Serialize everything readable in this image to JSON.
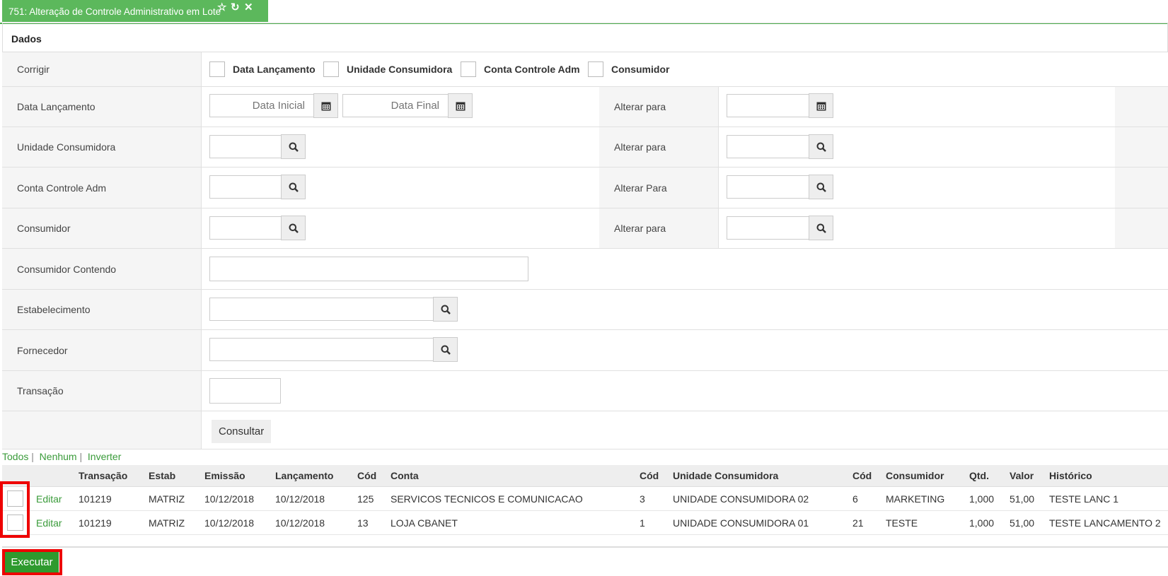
{
  "tab": {
    "title": "751: Alteração de Controle Administrativo em Lote",
    "star_icon": "☆",
    "refresh_icon": "↻",
    "close_icon": "✕"
  },
  "section": {
    "title": "Dados"
  },
  "form": {
    "corrigir_label": "Corrigir",
    "corrigir_options": [
      "Data Lançamento",
      "Unidade Consumidora",
      "Conta Controle Adm",
      "Consumidor"
    ],
    "data_lancamento": {
      "label": "Data Lançamento",
      "placeholder_inicial": "Data Inicial",
      "placeholder_final": "Data Final",
      "alterar_label": "Alterar para"
    },
    "unidade_consumidora": {
      "label": "Unidade Consumidora",
      "alterar_label": "Alterar para"
    },
    "conta_controle": {
      "label": "Conta Controle Adm",
      "alterar_label": "Alterar Para"
    },
    "consumidor": {
      "label": "Consumidor",
      "alterar_label": "Alterar para"
    },
    "consumidor_contendo": {
      "label": "Consumidor Contendo"
    },
    "estabelecimento": {
      "label": "Estabelecimento"
    },
    "fornecedor": {
      "label": "Fornecedor"
    },
    "transacao": {
      "label": "Transação"
    },
    "consultar_button": "Consultar"
  },
  "selection_links": {
    "todos": "Todos",
    "nenhum": "Nenhum",
    "inverter": "Inverter",
    "separator": "|"
  },
  "table": {
    "headers": [
      "Transação",
      "Estab",
      "Emissão",
      "Lançamento",
      "Cód",
      "Conta",
      "Cód",
      "Unidade Consumidora",
      "Cód",
      "Consumidor",
      "Qtd.",
      "Valor",
      "Histórico"
    ],
    "edit_label": "Editar",
    "rows": [
      [
        "101219",
        "MATRIZ",
        "10/12/2018",
        "10/12/2018",
        "125",
        "SERVICOS TECNICOS E COMUNICACAO",
        "3",
        "UNIDADE CONSUMIDORA 02",
        "6",
        "MARKETING",
        "1,000",
        "51,00",
        "TESTE LANC 1"
      ],
      [
        "101219",
        "MATRIZ",
        "10/12/2018",
        "10/12/2018",
        "13",
        "LOJA CBANET",
        "1",
        "UNIDADE CONSUMIDORA 01",
        "21",
        "TESTE",
        "1,000",
        "51,00",
        "TESTE LANCAMENTO 2"
      ]
    ]
  },
  "executar_button": "Executar",
  "colors": {
    "accent": "#5cb85c",
    "button_green": "#2e9a2e",
    "link_green": "#3a9b3a",
    "highlight_red": "#ee0000"
  }
}
